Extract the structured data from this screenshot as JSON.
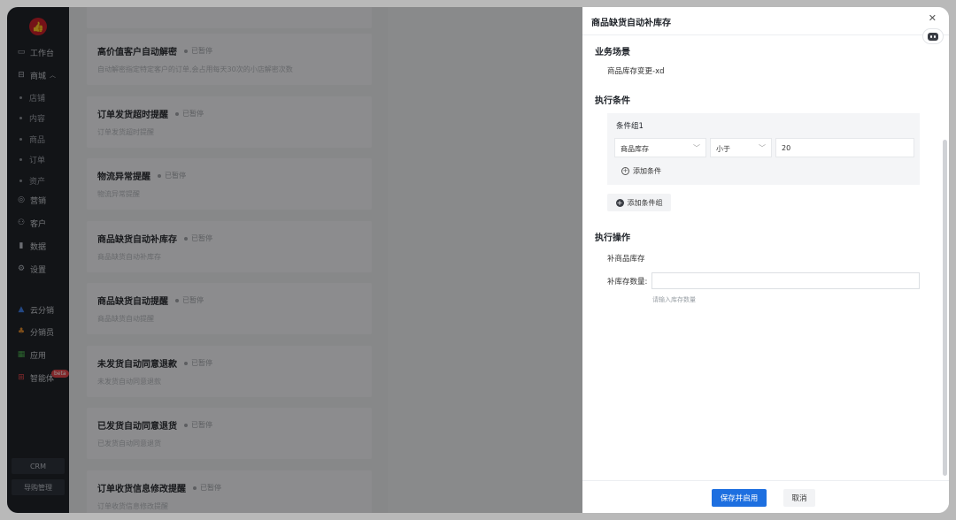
{
  "sidebar": {
    "logo_icon": "thumbs-up-icon",
    "items": [
      {
        "label": "工作台",
        "icon": "workbench-icon"
      },
      {
        "label": "商城",
        "icon": "mall-icon"
      },
      {
        "label": "店铺"
      },
      {
        "label": "内容"
      },
      {
        "label": "商品"
      },
      {
        "label": "订单"
      },
      {
        "label": "资产"
      },
      {
        "label": "营销",
        "icon": "marketing-icon"
      },
      {
        "label": "客户",
        "icon": "customer-icon"
      },
      {
        "label": "数据",
        "icon": "data-icon"
      },
      {
        "label": "设置",
        "icon": "settings-icon"
      },
      {
        "label": "云分销",
        "icon": "cloud-distribution-icon"
      },
      {
        "label": "分销员",
        "icon": "distributor-icon"
      },
      {
        "label": "应用",
        "icon": "apps-icon"
      },
      {
        "label": "智能体",
        "icon": "agent-icon"
      }
    ],
    "beta_badge": "beta",
    "crm_label": "CRM",
    "guide_label": "导购管理"
  },
  "list": [
    {
      "title": "高价值客户自动解密",
      "status": "已暂停",
      "desc": "自动解密指定特定客户的订单,会占用每天30次的小店解密次数"
    },
    {
      "title": "订单发货超时提醒",
      "status": "已暂停",
      "desc": "订单发货超时提醒"
    },
    {
      "title": "物流异常提醒",
      "status": "已暂停",
      "desc": "物流异常提醒"
    },
    {
      "title": "商品缺货自动补库存",
      "status": "已暂停",
      "desc": "商品缺货自动补库存"
    },
    {
      "title": "商品缺货自动提醒",
      "status": "已暂停",
      "desc": "商品缺货自动提醒"
    },
    {
      "title": "未发货自动同意退款",
      "status": "已暂停",
      "desc": "未发货自动同意退款"
    },
    {
      "title": "已发货自动同意退货",
      "status": "已暂停",
      "desc": "已发货自动同意退货"
    },
    {
      "title": "订单收货信息修改提醒",
      "status": "已暂停",
      "desc": "订单收货信息修改提醒"
    }
  ],
  "drawer": {
    "title": "商品缺货自动补库存",
    "scene_title": "业务场景",
    "scene_value": "商品库存变更-xd",
    "condition_title": "执行条件",
    "group_label": "条件组1",
    "field_select": "商品库存",
    "operator_select": "小于",
    "value_input": "20",
    "add_condition": "添加条件",
    "add_group": "添加条件组",
    "action_title": "执行操作",
    "action_name": "补商品库存",
    "qty_label": "补库存数量:",
    "qty_value": "",
    "qty_hint": "请输入库存数量",
    "save_label": "保存并启用",
    "cancel_label": "取消"
  }
}
